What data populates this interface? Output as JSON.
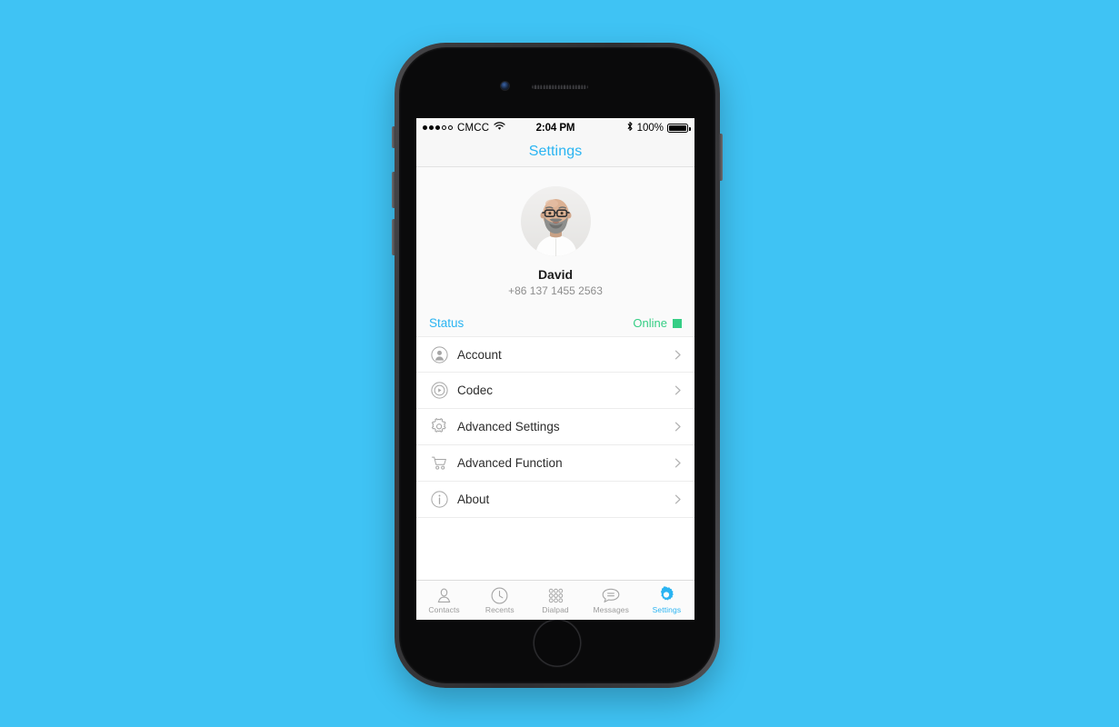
{
  "background_color": "#3fc3f4",
  "accent_blue": "#2ab4f2",
  "status_green": "#35ce85",
  "statusbar": {
    "carrier": "CMCC",
    "signal_dots_filled": 3,
    "signal_dots_total": 5,
    "wifi_icon": "wifi-icon",
    "time": "2:04 PM",
    "bluetooth_icon": "bluetooth-icon",
    "battery_percent": "100%",
    "battery_level": 100
  },
  "navbar": {
    "title": "Settings"
  },
  "profile": {
    "avatar_icon": "user-avatar-photo",
    "name": "David",
    "phone": "+86 137 1455 2563"
  },
  "status_section": {
    "label": "Status",
    "value": "Online",
    "indicator_color": "#35ce85"
  },
  "menu": {
    "items": [
      {
        "label": "Account",
        "icon": "account-circle-icon",
        "chevron": "chevron-right-icon"
      },
      {
        "label": "Codec",
        "icon": "codec-play-icon",
        "chevron": "chevron-right-icon"
      },
      {
        "label": "Advanced Settings",
        "icon": "gear-icon",
        "chevron": "chevron-right-icon"
      },
      {
        "label": "Advanced Function",
        "icon": "shopping-cart-icon",
        "chevron": "chevron-right-icon"
      },
      {
        "label": "About",
        "icon": "info-circle-icon",
        "chevron": "chevron-right-icon"
      }
    ]
  },
  "tabbar": {
    "tabs": [
      {
        "label": "Contacts",
        "icon": "contacts-person-icon",
        "active": false
      },
      {
        "label": "Recents",
        "icon": "clock-icon",
        "active": false
      },
      {
        "label": "Dialpad",
        "icon": "dialpad-grid-icon",
        "active": false
      },
      {
        "label": "Messages",
        "icon": "message-bubble-icon",
        "active": false
      },
      {
        "label": "Settings",
        "icon": "gear-filled-icon",
        "active": true
      }
    ]
  }
}
